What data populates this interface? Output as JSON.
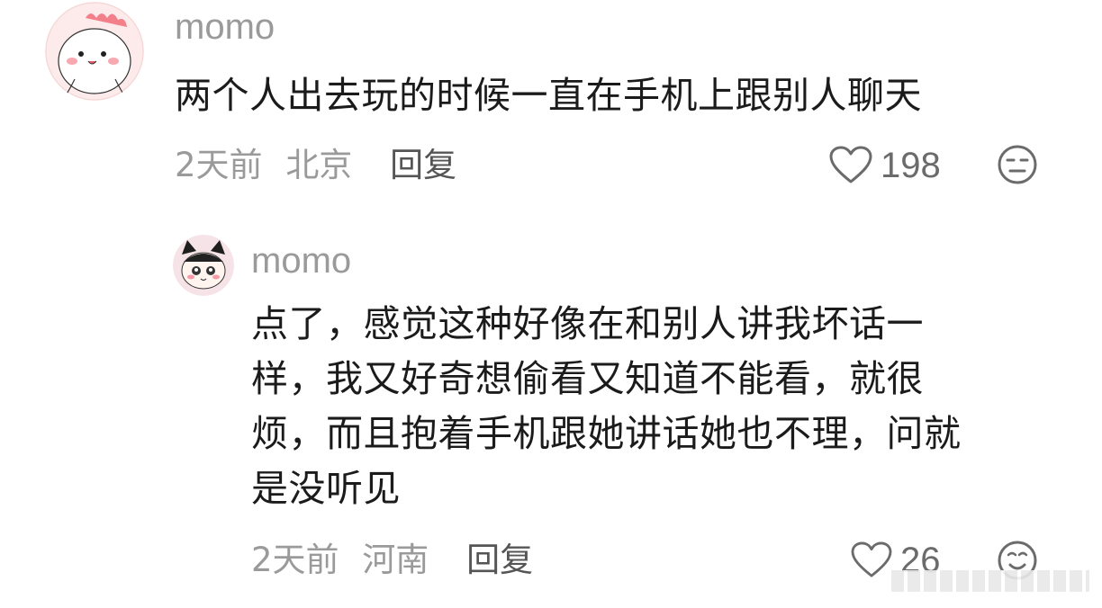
{
  "comments": [
    {
      "username": "momo",
      "text": "两个人出去玩的时候一直在手机上跟别人聊天",
      "time": "2天前",
      "location": "北京",
      "reply_label": "回复",
      "likes": "198",
      "avatar_icon": "dinosaur-avatar-icon"
    },
    {
      "username": "momo",
      "text_lines": [
        "点了，感觉这种好像在和别人讲我坏话一",
        "样，我又好奇想偷看又知道不能看，就很",
        "烦，而且抱着手机跟她讲话她也不理，问就",
        "是没听见"
      ],
      "time": "2天前",
      "location": "河南",
      "reply_label": "回复",
      "likes": "26",
      "avatar_icon": "cat-ears-avatar-icon"
    }
  ],
  "colors": {
    "meta_gray": "#9a9a9a",
    "text_dark": "#1b1b1b",
    "reply_gray": "#555555"
  }
}
